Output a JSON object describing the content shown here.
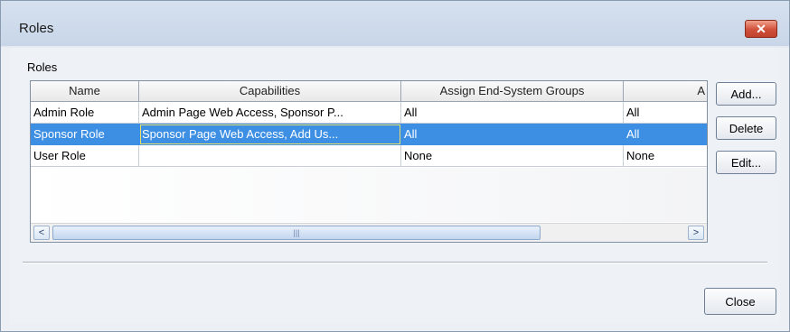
{
  "window": {
    "title": "Roles",
    "close_glyph": "✕"
  },
  "group": {
    "label": "Roles"
  },
  "table": {
    "columns": [
      "Name",
      "Capabilities",
      "Assign End-System Groups",
      "A"
    ],
    "rows": [
      {
        "name": "Admin Role",
        "capabilities": "Admin Page Web Access, Sponsor P...",
        "assign": "All",
        "col4": "All",
        "selected": false
      },
      {
        "name": "Sponsor Role",
        "capabilities": "Sponsor Page Web Access, Add Us...",
        "assign": "All",
        "col4": "All",
        "selected": true
      },
      {
        "name": "User Role",
        "capabilities": "",
        "assign": "None",
        "col4": "None",
        "selected": false
      }
    ],
    "scroll_left_glyph": "<",
    "scroll_right_glyph": ">",
    "scroll_thumb_grip": "|||"
  },
  "buttons": {
    "add": "Add...",
    "delete": "Delete",
    "edit": "Edit...",
    "close": "Close"
  },
  "colors": {
    "selection": "#3d8fe4",
    "close_button": "#d0503a"
  },
  "icons": [
    "close-icon",
    "scroll-left-icon",
    "scroll-right-icon"
  ]
}
